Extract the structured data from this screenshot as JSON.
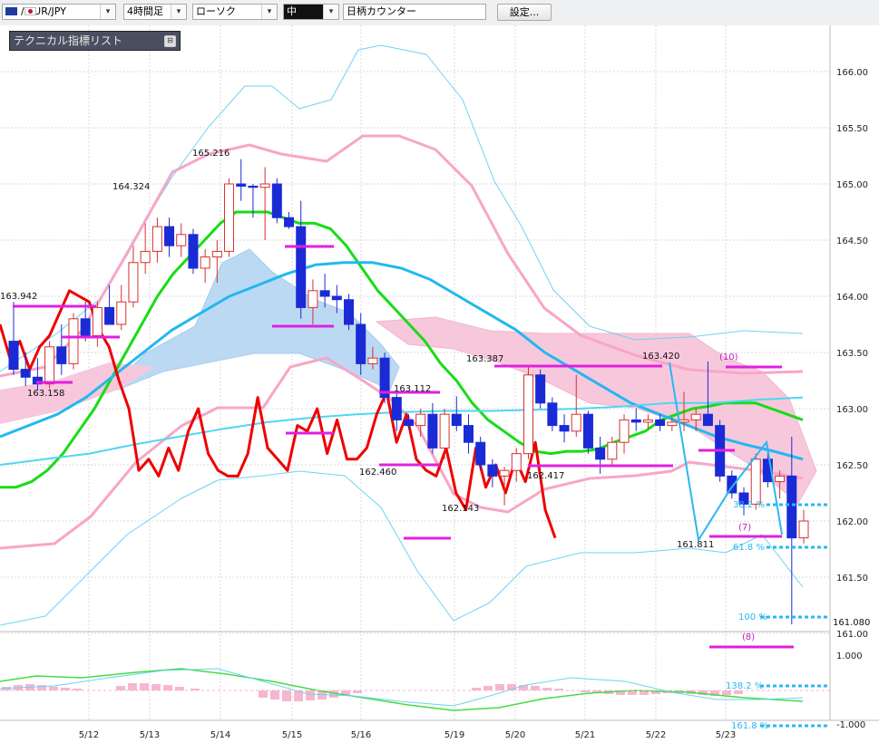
{
  "toolbar": {
    "symbol": "/ EUR/JPY",
    "timeframe": "4時間足",
    "chart_style": "ローソク",
    "size": "中",
    "counter": "日柄カウンター",
    "settings_label": "設定..."
  },
  "indicator_panel": {
    "title": "テクニカル指標リスト"
  },
  "chart_data": {
    "type": "candlestick",
    "symbol": "EUR/JPY",
    "timeframe": "4時間足",
    "x_labels": [
      "5/12",
      "5/13",
      "5/14",
      "5/15",
      "5/16",
      "5/19",
      "5/20",
      "5/21",
      "5/22",
      "5/23"
    ],
    "y_ticks": [
      "166.00",
      "165.50",
      "165.00",
      "164.50",
      "164.00",
      "163.50",
      "163.00",
      "162.50",
      "162.00",
      "161.50",
      "161.00"
    ],
    "ylim": [
      160.85,
      166.3
    ],
    "oscillator_ticks": [
      "1.000",
      "-1.000"
    ],
    "price_annotations": [
      "163.942",
      "163.158",
      "164.324",
      "165.216",
      "163.112",
      "162.460",
      "162.143",
      "163.387",
      "162.417",
      "163.420",
      "161.811",
      "161.080"
    ],
    "fibonacci_labels": [
      "38.2 %",
      "61.8 %",
      "100 %",
      "138.2 %",
      "161.8 %"
    ],
    "count_labels": [
      "(10)",
      "(7)",
      "(8)"
    ],
    "candles": [
      {
        "o": 163.6,
        "h": 163.95,
        "l": 163.3,
        "c": 163.35
      },
      {
        "o": 163.35,
        "h": 163.5,
        "l": 163.2,
        "c": 163.28
      },
      {
        "o": 163.28,
        "h": 163.45,
        "l": 163.16,
        "c": 163.22
      },
      {
        "o": 163.22,
        "h": 163.6,
        "l": 163.18,
        "c": 163.55
      },
      {
        "o": 163.55,
        "h": 163.75,
        "l": 163.3,
        "c": 163.4
      },
      {
        "o": 163.4,
        "h": 163.85,
        "l": 163.35,
        "c": 163.8
      },
      {
        "o": 163.8,
        "h": 163.95,
        "l": 163.6,
        "c": 163.65
      },
      {
        "o": 163.65,
        "h": 163.95,
        "l": 163.55,
        "c": 163.9
      },
      {
        "o": 163.9,
        "h": 164.1,
        "l": 163.8,
        "c": 163.75
      },
      {
        "o": 163.75,
        "h": 164.1,
        "l": 163.7,
        "c": 163.95
      },
      {
        "o": 163.95,
        "h": 164.45,
        "l": 163.9,
        "c": 164.3
      },
      {
        "o": 164.3,
        "h": 164.65,
        "l": 164.2,
        "c": 164.4
      },
      {
        "o": 164.4,
        "h": 164.7,
        "l": 164.3,
        "c": 164.62
      },
      {
        "o": 164.62,
        "h": 164.7,
        "l": 164.35,
        "c": 164.45
      },
      {
        "o": 164.45,
        "h": 164.65,
        "l": 164.35,
        "c": 164.55
      },
      {
        "o": 164.55,
        "h": 164.6,
        "l": 164.2,
        "c": 164.25
      },
      {
        "o": 164.25,
        "h": 164.42,
        "l": 164.12,
        "c": 164.35
      },
      {
        "o": 164.35,
        "h": 164.5,
        "l": 164.12,
        "c": 164.4
      },
      {
        "o": 164.4,
        "h": 165.05,
        "l": 164.35,
        "c": 165.0
      },
      {
        "o": 165.0,
        "h": 165.22,
        "l": 164.85,
        "c": 164.98
      },
      {
        "o": 164.98,
        "h": 165.0,
        "l": 164.7,
        "c": 164.97
      },
      {
        "o": 164.97,
        "h": 165.15,
        "l": 164.5,
        "c": 165.0
      },
      {
        "o": 165.0,
        "h": 165.05,
        "l": 164.65,
        "c": 164.7
      },
      {
        "o": 164.7,
        "h": 164.75,
        "l": 164.6,
        "c": 164.62
      },
      {
        "o": 164.62,
        "h": 164.85,
        "l": 163.8,
        "c": 163.9
      },
      {
        "o": 163.9,
        "h": 164.15,
        "l": 163.75,
        "c": 164.05
      },
      {
        "o": 164.05,
        "h": 164.2,
        "l": 163.9,
        "c": 164.0
      },
      {
        "o": 164.0,
        "h": 164.1,
        "l": 163.85,
        "c": 163.97
      },
      {
        "o": 163.97,
        "h": 164.02,
        "l": 163.7,
        "c": 163.75
      },
      {
        "o": 163.75,
        "h": 163.85,
        "l": 163.3,
        "c": 163.4
      },
      {
        "o": 163.4,
        "h": 163.55,
        "l": 163.35,
        "c": 163.45
      },
      {
        "o": 163.45,
        "h": 163.5,
        "l": 163.05,
        "c": 163.1
      },
      {
        "o": 163.1,
        "h": 163.15,
        "l": 162.8,
        "c": 162.9
      },
      {
        "o": 162.9,
        "h": 162.95,
        "l": 162.82,
        "c": 162.85
      },
      {
        "o": 162.85,
        "h": 163.0,
        "l": 162.75,
        "c": 162.95
      },
      {
        "o": 162.95,
        "h": 163.05,
        "l": 162.6,
        "c": 162.65
      },
      {
        "o": 162.65,
        "h": 163.0,
        "l": 162.55,
        "c": 162.95
      },
      {
        "o": 162.95,
        "h": 163.11,
        "l": 162.8,
        "c": 162.85
      },
      {
        "o": 162.85,
        "h": 162.95,
        "l": 162.6,
        "c": 162.7
      },
      {
        "o": 162.7,
        "h": 162.75,
        "l": 162.45,
        "c": 162.5
      },
      {
        "o": 162.5,
        "h": 162.55,
        "l": 162.3,
        "c": 162.4
      },
      {
        "o": 162.4,
        "h": 162.48,
        "l": 162.14,
        "c": 162.45
      },
      {
        "o": 162.45,
        "h": 162.65,
        "l": 162.35,
        "c": 162.6
      },
      {
        "o": 162.6,
        "h": 163.38,
        "l": 162.55,
        "c": 163.3
      },
      {
        "o": 163.3,
        "h": 163.35,
        "l": 163.0,
        "c": 163.05
      },
      {
        "o": 163.05,
        "h": 163.1,
        "l": 162.8,
        "c": 162.85
      },
      {
        "o": 162.85,
        "h": 162.95,
        "l": 162.7,
        "c": 162.8
      },
      {
        "o": 162.8,
        "h": 163.3,
        "l": 162.75,
        "c": 162.95
      },
      {
        "o": 162.95,
        "h": 162.98,
        "l": 162.6,
        "c": 162.65
      },
      {
        "o": 162.65,
        "h": 162.75,
        "l": 162.42,
        "c": 162.55
      },
      {
        "o": 162.55,
        "h": 162.75,
        "l": 162.5,
        "c": 162.7
      },
      {
        "o": 162.7,
        "h": 162.95,
        "l": 162.6,
        "c": 162.9
      },
      {
        "o": 162.9,
        "h": 163.0,
        "l": 162.8,
        "c": 162.88
      },
      {
        "o": 162.88,
        "h": 162.95,
        "l": 162.82,
        "c": 162.9
      },
      {
        "o": 162.9,
        "h": 162.95,
        "l": 162.8,
        "c": 162.85
      },
      {
        "o": 162.85,
        "h": 162.92,
        "l": 162.8,
        "c": 162.88
      },
      {
        "o": 162.88,
        "h": 163.15,
        "l": 162.8,
        "c": 162.9
      },
      {
        "o": 162.9,
        "h": 163.0,
        "l": 162.8,
        "c": 162.95
      },
      {
        "o": 162.95,
        "h": 163.42,
        "l": 162.85,
        "c": 162.85
      },
      {
        "o": 162.85,
        "h": 162.9,
        "l": 162.35,
        "c": 162.4
      },
      {
        "o": 162.4,
        "h": 162.45,
        "l": 162.2,
        "c": 162.25
      },
      {
        "o": 162.25,
        "h": 162.3,
        "l": 162.05,
        "c": 162.15
      },
      {
        "o": 162.15,
        "h": 162.6,
        "l": 162.1,
        "c": 162.55
      },
      {
        "o": 162.55,
        "h": 162.65,
        "l": 162.3,
        "c": 162.35
      },
      {
        "o": 162.35,
        "h": 162.45,
        "l": 162.2,
        "c": 162.4
      },
      {
        "o": 162.4,
        "h": 162.75,
        "l": 161.08,
        "c": 161.85
      },
      {
        "o": 161.85,
        "h": 162.1,
        "l": 161.8,
        "c": 162.0
      }
    ],
    "ma_green": [
      162.3,
      162.3,
      162.35,
      162.45,
      162.6,
      162.8,
      163.0,
      163.25,
      163.5,
      163.75,
      164.0,
      164.2,
      164.35,
      164.5,
      164.65,
      164.75,
      164.75,
      164.75,
      164.7,
      164.65,
      164.65,
      164.6,
      164.45,
      164.25,
      164.05,
      163.9,
      163.75,
      163.6,
      163.4,
      163.25,
      163.05,
      162.9,
      162.8,
      162.7,
      162.62,
      162.6,
      162.62,
      162.62,
      162.64,
      162.7,
      162.75,
      162.8,
      162.9,
      162.95,
      163.0,
      163.02,
      163.05,
      163.05,
      163.05,
      163.0,
      162.95,
      162.9
    ],
    "ma_blue": [
      162.75,
      162.85,
      162.95,
      163.1,
      163.3,
      163.5,
      163.7,
      163.85,
      164.0,
      164.1,
      164.2,
      164.28,
      164.3,
      164.3,
      164.25,
      164.15,
      164.0,
      163.85,
      163.7,
      163.5,
      163.35,
      163.2,
      163.05,
      162.95,
      162.85,
      162.75,
      162.68,
      162.62,
      162.55
    ],
    "ma_cyan": [
      162.5,
      162.55,
      162.6,
      162.68,
      162.75,
      162.82,
      162.88,
      162.92,
      162.95,
      162.97,
      162.98,
      162.98,
      162.99,
      163.0,
      163.02,
      163.05,
      163.05,
      163.08,
      163.1
    ],
    "lag_red": [
      163.75,
      163.45,
      163.6,
      163.35,
      163.55,
      163.65,
      163.85,
      164.05,
      164.0,
      163.95,
      163.7,
      163.55,
      163.25,
      163.0,
      162.45,
      162.55,
      162.4,
      162.65,
      162.45,
      162.8,
      163.0,
      162.6,
      162.45,
      162.4,
      162.4,
      162.6,
      163.1,
      162.65,
      162.55,
      162.45,
      162.85,
      162.8,
      163.0,
      162.6,
      162.9,
      162.55,
      162.55,
      162.65,
      162.95,
      163.15,
      162.7,
      162.95,
      162.55,
      162.45,
      162.4,
      162.65,
      162.25,
      162.1,
      162.65,
      162.3,
      162.5,
      162.25,
      162.55,
      162.35,
      162.7,
      162.1,
      161.85
    ]
  }
}
